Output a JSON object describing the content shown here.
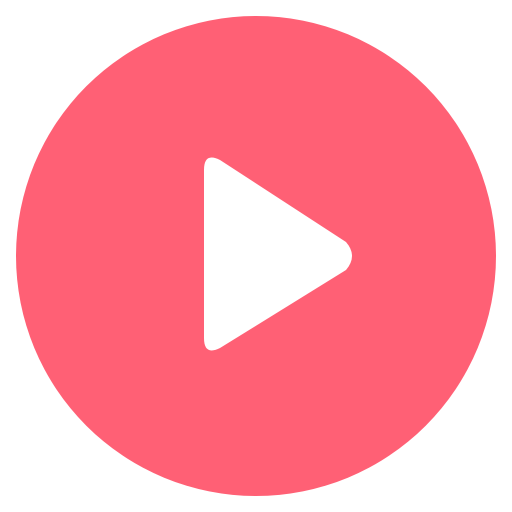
{
  "play_button": {
    "icon": "play-icon",
    "circle_color": "#FF6075",
    "glyph_color": "#FFFFFF"
  }
}
